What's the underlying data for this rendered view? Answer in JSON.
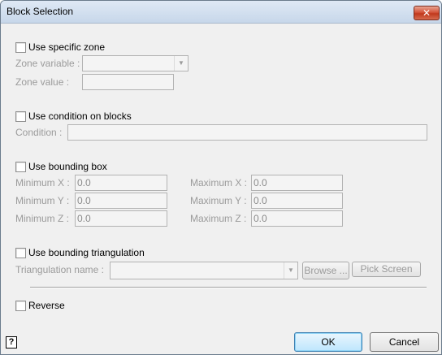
{
  "window": {
    "title": "Block Selection",
    "close_glyph": "✕"
  },
  "zone": {
    "checkbox_label": "Use specific zone",
    "variable_label": "Zone variable :",
    "variable_value": "",
    "value_label": "Zone value :",
    "value_value": ""
  },
  "condition": {
    "checkbox_label": "Use condition on blocks",
    "condition_label": "Condition :",
    "condition_value": ""
  },
  "bounding_box": {
    "checkbox_label": "Use bounding box",
    "min_x_label": "Minimum X :",
    "min_x": "0.0",
    "min_y_label": "Minimum Y :",
    "min_y": "0.0",
    "min_z_label": "Minimum Z :",
    "min_z": "0.0",
    "max_x_label": "Maximum X :",
    "max_x": "0.0",
    "max_y_label": "Maximum Y :",
    "max_y": "0.0",
    "max_z_label": "Maximum Z :",
    "max_z": "0.0"
  },
  "triangulation": {
    "checkbox_label": "Use bounding triangulation",
    "name_label": "Triangulation name :",
    "name_value": "",
    "browse_label": "Browse ...",
    "pick_label": "Pick Screen"
  },
  "reverse": {
    "checkbox_label": "Reverse"
  },
  "footer": {
    "help_glyph": "?",
    "ok_label": "OK",
    "cancel_label": "Cancel"
  }
}
